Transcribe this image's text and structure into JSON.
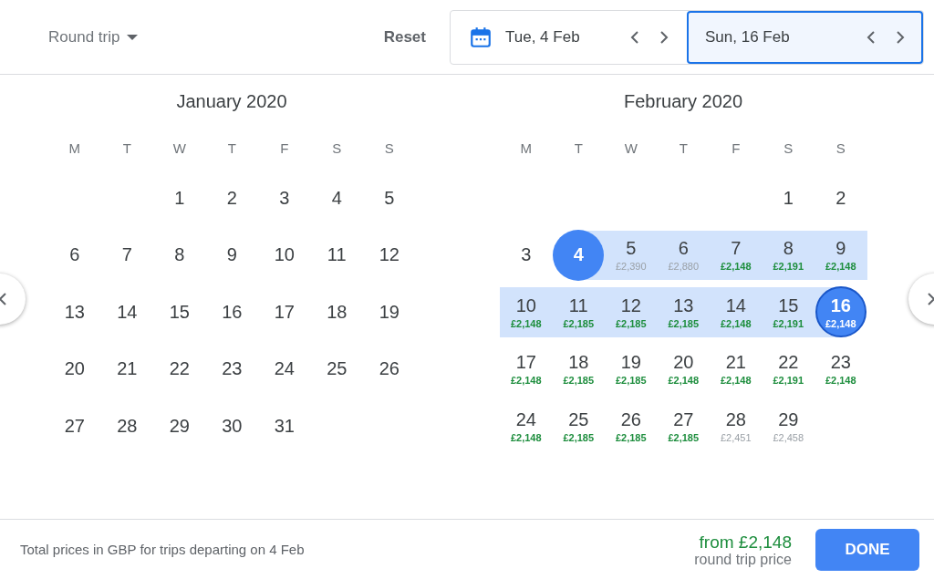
{
  "header": {
    "trip_type": "Round trip",
    "reset": "Reset",
    "date_fields": [
      {
        "date": "Tue, 4 Feb",
        "selected": false,
        "has_icon": true
      },
      {
        "date": "Sun, 16 Feb",
        "selected": true,
        "has_icon": false
      }
    ]
  },
  "months": [
    {
      "title": "January 2020",
      "weekdays": [
        "M",
        "T",
        "W",
        "T",
        "F",
        "S",
        "S"
      ],
      "weeks": [
        [
          {
            "day": "1"
          },
          {
            "day": "2"
          },
          {
            "day": "3"
          },
          {
            "day": "4"
          },
          {
            "day": "5"
          }
        ],
        [
          {
            "day": "6"
          },
          {
            "day": "7"
          },
          {
            "day": "8"
          },
          {
            "day": "9"
          },
          {
            "day": "10"
          },
          {
            "day": "11"
          },
          {
            "day": "12"
          }
        ],
        [
          {
            "day": "13"
          },
          {
            "day": "14"
          },
          {
            "day": "15"
          },
          {
            "day": "16"
          },
          {
            "day": "17"
          },
          {
            "day": "18"
          },
          {
            "day": "19"
          }
        ],
        [
          {
            "day": "20"
          },
          {
            "day": "21"
          },
          {
            "day": "22"
          },
          {
            "day": "23"
          },
          {
            "day": "24"
          },
          {
            "day": "25"
          },
          {
            "day": "26"
          }
        ],
        [
          {
            "day": "27"
          },
          {
            "day": "28"
          },
          {
            "day": "29"
          },
          {
            "day": "30"
          },
          {
            "day": "31"
          }
        ]
      ]
    },
    {
      "title": "February 2020",
      "weekdays": [
        "M",
        "T",
        "W",
        "T",
        "F",
        "S",
        "S"
      ],
      "weeks": [
        [
          {
            "day": "1"
          },
          {
            "day": "2"
          }
        ],
        [
          {
            "day": "3"
          },
          {
            "day": "4",
            "selected": true,
            "in_range": true
          },
          {
            "day": "5",
            "price": "£2,390",
            "cheap": false,
            "in_range": true
          },
          {
            "day": "6",
            "price": "£2,880",
            "cheap": false,
            "in_range": true
          },
          {
            "day": "7",
            "price": "£2,148",
            "cheap": true,
            "in_range": true
          },
          {
            "day": "8",
            "price": "£2,191",
            "cheap": true,
            "in_range": true
          },
          {
            "day": "9",
            "price": "£2,148",
            "cheap": true,
            "in_range": true
          }
        ],
        [
          {
            "day": "10",
            "price": "£2,148",
            "cheap": true,
            "in_range": true
          },
          {
            "day": "11",
            "price": "£2,185",
            "cheap": true,
            "in_range": true
          },
          {
            "day": "12",
            "price": "£2,185",
            "cheap": true,
            "in_range": true
          },
          {
            "day": "13",
            "price": "£2,185",
            "cheap": true,
            "in_range": true
          },
          {
            "day": "14",
            "price": "£2,148",
            "cheap": true,
            "in_range": true
          },
          {
            "day": "15",
            "price": "£2,191",
            "cheap": true,
            "in_range": true
          },
          {
            "day": "16",
            "price": "£2,148",
            "cheap": true,
            "selected": true,
            "in_range": true
          }
        ],
        [
          {
            "day": "17",
            "price": "£2,148",
            "cheap": true
          },
          {
            "day": "18",
            "price": "£2,185",
            "cheap": true
          },
          {
            "day": "19",
            "price": "£2,185",
            "cheap": true
          },
          {
            "day": "20",
            "price": "£2,148",
            "cheap": true
          },
          {
            "day": "21",
            "price": "£2,148",
            "cheap": true
          },
          {
            "day": "22",
            "price": "£2,191",
            "cheap": true
          },
          {
            "day": "23",
            "price": "£2,148",
            "cheap": true
          }
        ],
        [
          {
            "day": "24",
            "price": "£2,148",
            "cheap": true
          },
          {
            "day": "25",
            "price": "£2,185",
            "cheap": true
          },
          {
            "day": "26",
            "price": "£2,185",
            "cheap": true
          },
          {
            "day": "27",
            "price": "£2,185",
            "cheap": true
          },
          {
            "day": "28",
            "price": "£2,451",
            "cheap": false
          },
          {
            "day": "29",
            "price": "£2,458",
            "cheap": false
          }
        ]
      ]
    }
  ],
  "footer": {
    "note": "Total prices in GBP for trips departing on 4 Feb",
    "price": "from £2,148",
    "price_caption": "round trip price",
    "done": "DONE"
  }
}
